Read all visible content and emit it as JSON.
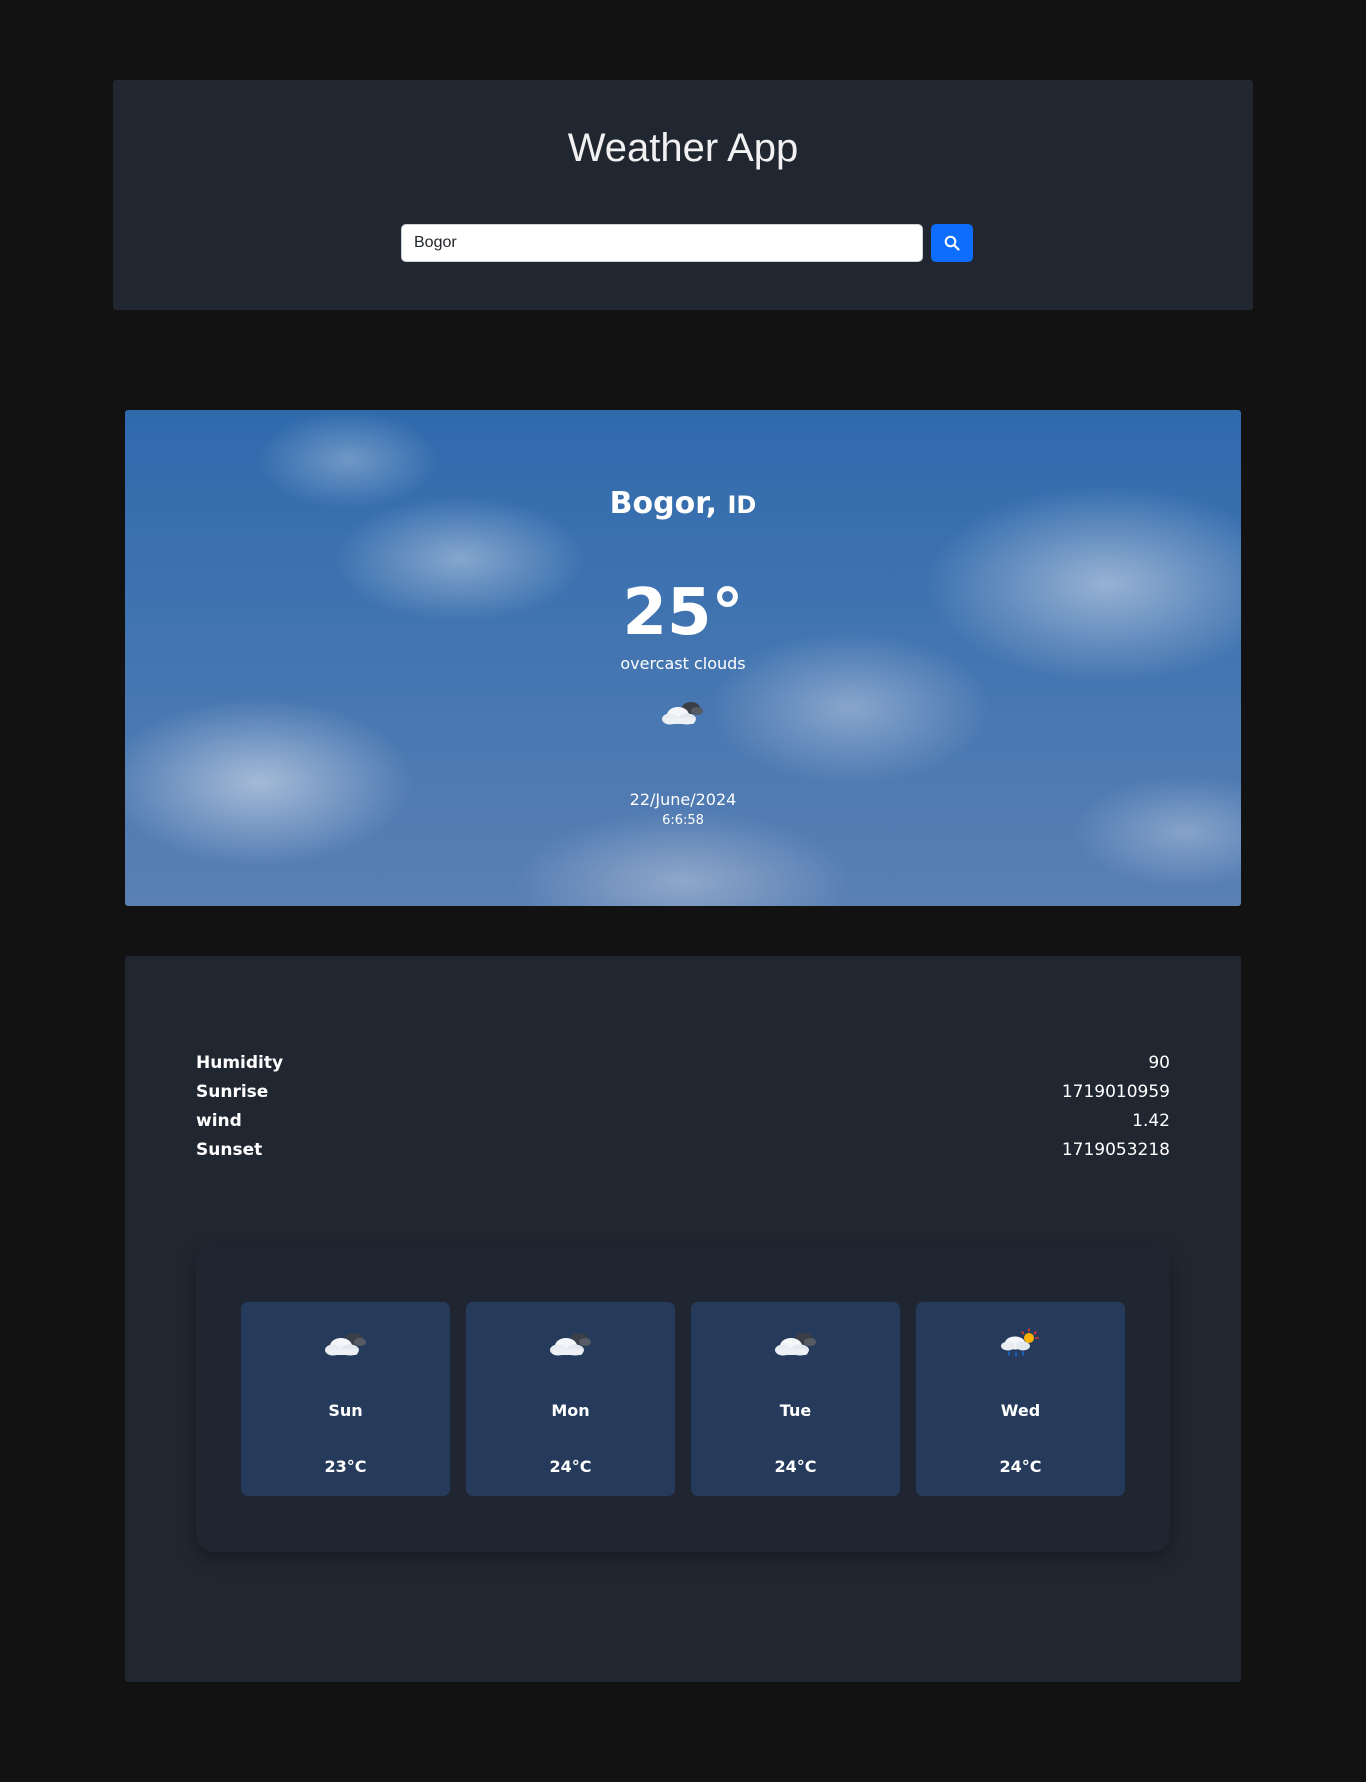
{
  "header": {
    "title": "Weather App",
    "search": {
      "value": "Bogor",
      "placeholder": ""
    },
    "search_icon": "search-icon"
  },
  "current": {
    "city": "Bogor,",
    "country": "ID",
    "temperature": "25°",
    "description": "overcast clouds",
    "icon": "cloudy-icon",
    "date": "22/June/2024",
    "time": "6:6:58"
  },
  "stats": [
    {
      "label": "Humidity",
      "value": "90"
    },
    {
      "label": "Sunrise",
      "value": "1719010959"
    },
    {
      "label": "wind",
      "value": "1.42"
    },
    {
      "label": "Sunset",
      "value": "1719053218"
    }
  ],
  "forecast": [
    {
      "day": "Sun",
      "temp": "23°C",
      "icon": "cloudy-icon"
    },
    {
      "day": "Mon",
      "temp": "24°C",
      "icon": "cloudy-icon"
    },
    {
      "day": "Tue",
      "temp": "24°C",
      "icon": "cloudy-icon"
    },
    {
      "day": "Wed",
      "temp": "24°C",
      "icon": "sun-rain-icon"
    }
  ],
  "colors": {
    "page_bg": "#121212",
    "panel_bg": "#212731",
    "card_bg": "#263b5b",
    "accent": "#0d6efd"
  }
}
